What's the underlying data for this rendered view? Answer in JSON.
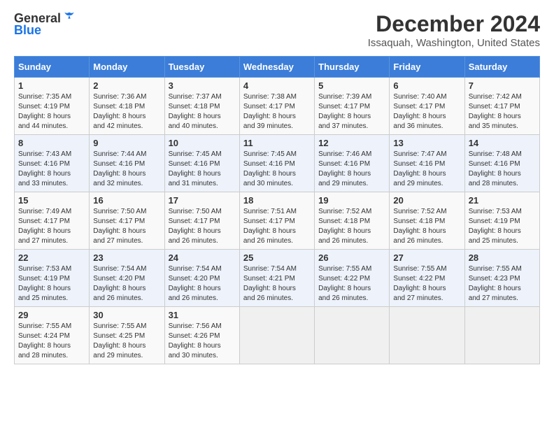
{
  "logo": {
    "text_general": "General",
    "text_blue": "Blue"
  },
  "title": "December 2024",
  "subtitle": "Issaquah, Washington, United States",
  "days_of_week": [
    "Sunday",
    "Monday",
    "Tuesday",
    "Wednesday",
    "Thursday",
    "Friday",
    "Saturday"
  ],
  "weeks": [
    [
      {
        "day": "1",
        "sunrise": "7:35 AM",
        "sunset": "4:19 PM",
        "daylight": "8 hours and 44 minutes."
      },
      {
        "day": "2",
        "sunrise": "7:36 AM",
        "sunset": "4:18 PM",
        "daylight": "8 hours and 42 minutes."
      },
      {
        "day": "3",
        "sunrise": "7:37 AM",
        "sunset": "4:18 PM",
        "daylight": "8 hours and 40 minutes."
      },
      {
        "day": "4",
        "sunrise": "7:38 AM",
        "sunset": "4:17 PM",
        "daylight": "8 hours and 39 minutes."
      },
      {
        "day": "5",
        "sunrise": "7:39 AM",
        "sunset": "4:17 PM",
        "daylight": "8 hours and 37 minutes."
      },
      {
        "day": "6",
        "sunrise": "7:40 AM",
        "sunset": "4:17 PM",
        "daylight": "8 hours and 36 minutes."
      },
      {
        "day": "7",
        "sunrise": "7:42 AM",
        "sunset": "4:17 PM",
        "daylight": "8 hours and 35 minutes."
      }
    ],
    [
      {
        "day": "8",
        "sunrise": "7:43 AM",
        "sunset": "4:16 PM",
        "daylight": "8 hours and 33 minutes."
      },
      {
        "day": "9",
        "sunrise": "7:44 AM",
        "sunset": "4:16 PM",
        "daylight": "8 hours and 32 minutes."
      },
      {
        "day": "10",
        "sunrise": "7:45 AM",
        "sunset": "4:16 PM",
        "daylight": "8 hours and 31 minutes."
      },
      {
        "day": "11",
        "sunrise": "7:45 AM",
        "sunset": "4:16 PM",
        "daylight": "8 hours and 30 minutes."
      },
      {
        "day": "12",
        "sunrise": "7:46 AM",
        "sunset": "4:16 PM",
        "daylight": "8 hours and 29 minutes."
      },
      {
        "day": "13",
        "sunrise": "7:47 AM",
        "sunset": "4:16 PM",
        "daylight": "8 hours and 29 minutes."
      },
      {
        "day": "14",
        "sunrise": "7:48 AM",
        "sunset": "4:16 PM",
        "daylight": "8 hours and 28 minutes."
      }
    ],
    [
      {
        "day": "15",
        "sunrise": "7:49 AM",
        "sunset": "4:17 PM",
        "daylight": "8 hours and 27 minutes."
      },
      {
        "day": "16",
        "sunrise": "7:50 AM",
        "sunset": "4:17 PM",
        "daylight": "8 hours and 27 minutes."
      },
      {
        "day": "17",
        "sunrise": "7:50 AM",
        "sunset": "4:17 PM",
        "daylight": "8 hours and 26 minutes."
      },
      {
        "day": "18",
        "sunrise": "7:51 AM",
        "sunset": "4:17 PM",
        "daylight": "8 hours and 26 minutes."
      },
      {
        "day": "19",
        "sunrise": "7:52 AM",
        "sunset": "4:18 PM",
        "daylight": "8 hours and 26 minutes."
      },
      {
        "day": "20",
        "sunrise": "7:52 AM",
        "sunset": "4:18 PM",
        "daylight": "8 hours and 26 minutes."
      },
      {
        "day": "21",
        "sunrise": "7:53 AM",
        "sunset": "4:19 PM",
        "daylight": "8 hours and 25 minutes."
      }
    ],
    [
      {
        "day": "22",
        "sunrise": "7:53 AM",
        "sunset": "4:19 PM",
        "daylight": "8 hours and 25 minutes."
      },
      {
        "day": "23",
        "sunrise": "7:54 AM",
        "sunset": "4:20 PM",
        "daylight": "8 hours and 26 minutes."
      },
      {
        "day": "24",
        "sunrise": "7:54 AM",
        "sunset": "4:20 PM",
        "daylight": "8 hours and 26 minutes."
      },
      {
        "day": "25",
        "sunrise": "7:54 AM",
        "sunset": "4:21 PM",
        "daylight": "8 hours and 26 minutes."
      },
      {
        "day": "26",
        "sunrise": "7:55 AM",
        "sunset": "4:22 PM",
        "daylight": "8 hours and 26 minutes."
      },
      {
        "day": "27",
        "sunrise": "7:55 AM",
        "sunset": "4:22 PM",
        "daylight": "8 hours and 27 minutes."
      },
      {
        "day": "28",
        "sunrise": "7:55 AM",
        "sunset": "4:23 PM",
        "daylight": "8 hours and 27 minutes."
      }
    ],
    [
      {
        "day": "29",
        "sunrise": "7:55 AM",
        "sunset": "4:24 PM",
        "daylight": "8 hours and 28 minutes."
      },
      {
        "day": "30",
        "sunrise": "7:55 AM",
        "sunset": "4:25 PM",
        "daylight": "8 hours and 29 minutes."
      },
      {
        "day": "31",
        "sunrise": "7:56 AM",
        "sunset": "4:26 PM",
        "daylight": "8 hours and 30 minutes."
      },
      null,
      null,
      null,
      null
    ]
  ],
  "labels": {
    "sunrise": "Sunrise:",
    "sunset": "Sunset:",
    "daylight": "Daylight:"
  }
}
